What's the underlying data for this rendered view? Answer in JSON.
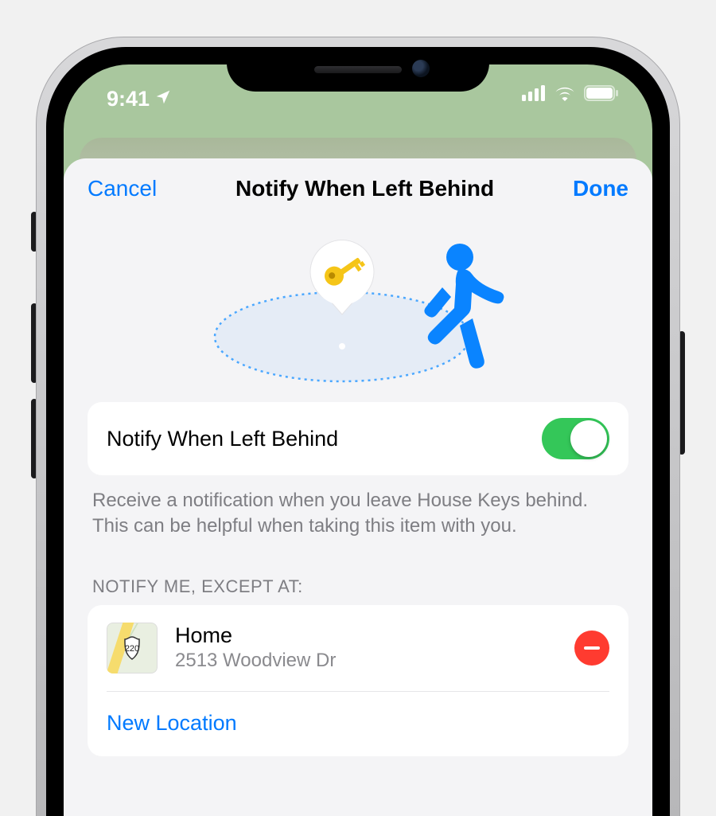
{
  "status": {
    "time": "9:41"
  },
  "sheet": {
    "cancel": "Cancel",
    "title": "Notify When Left Behind",
    "done": "Done",
    "toggle_label": "Notify When Left Behind",
    "toggle_on": true,
    "description": "Receive a notification when you leave House Keys behind. This can be helpful when taking this item with you.",
    "except_section_label": "NOTIFY ME, EXCEPT AT:",
    "exceptions": [
      {
        "name": "Home",
        "address": "2513 Woodview Dr",
        "route_badge": "220"
      }
    ],
    "new_location_label": "New Location"
  }
}
